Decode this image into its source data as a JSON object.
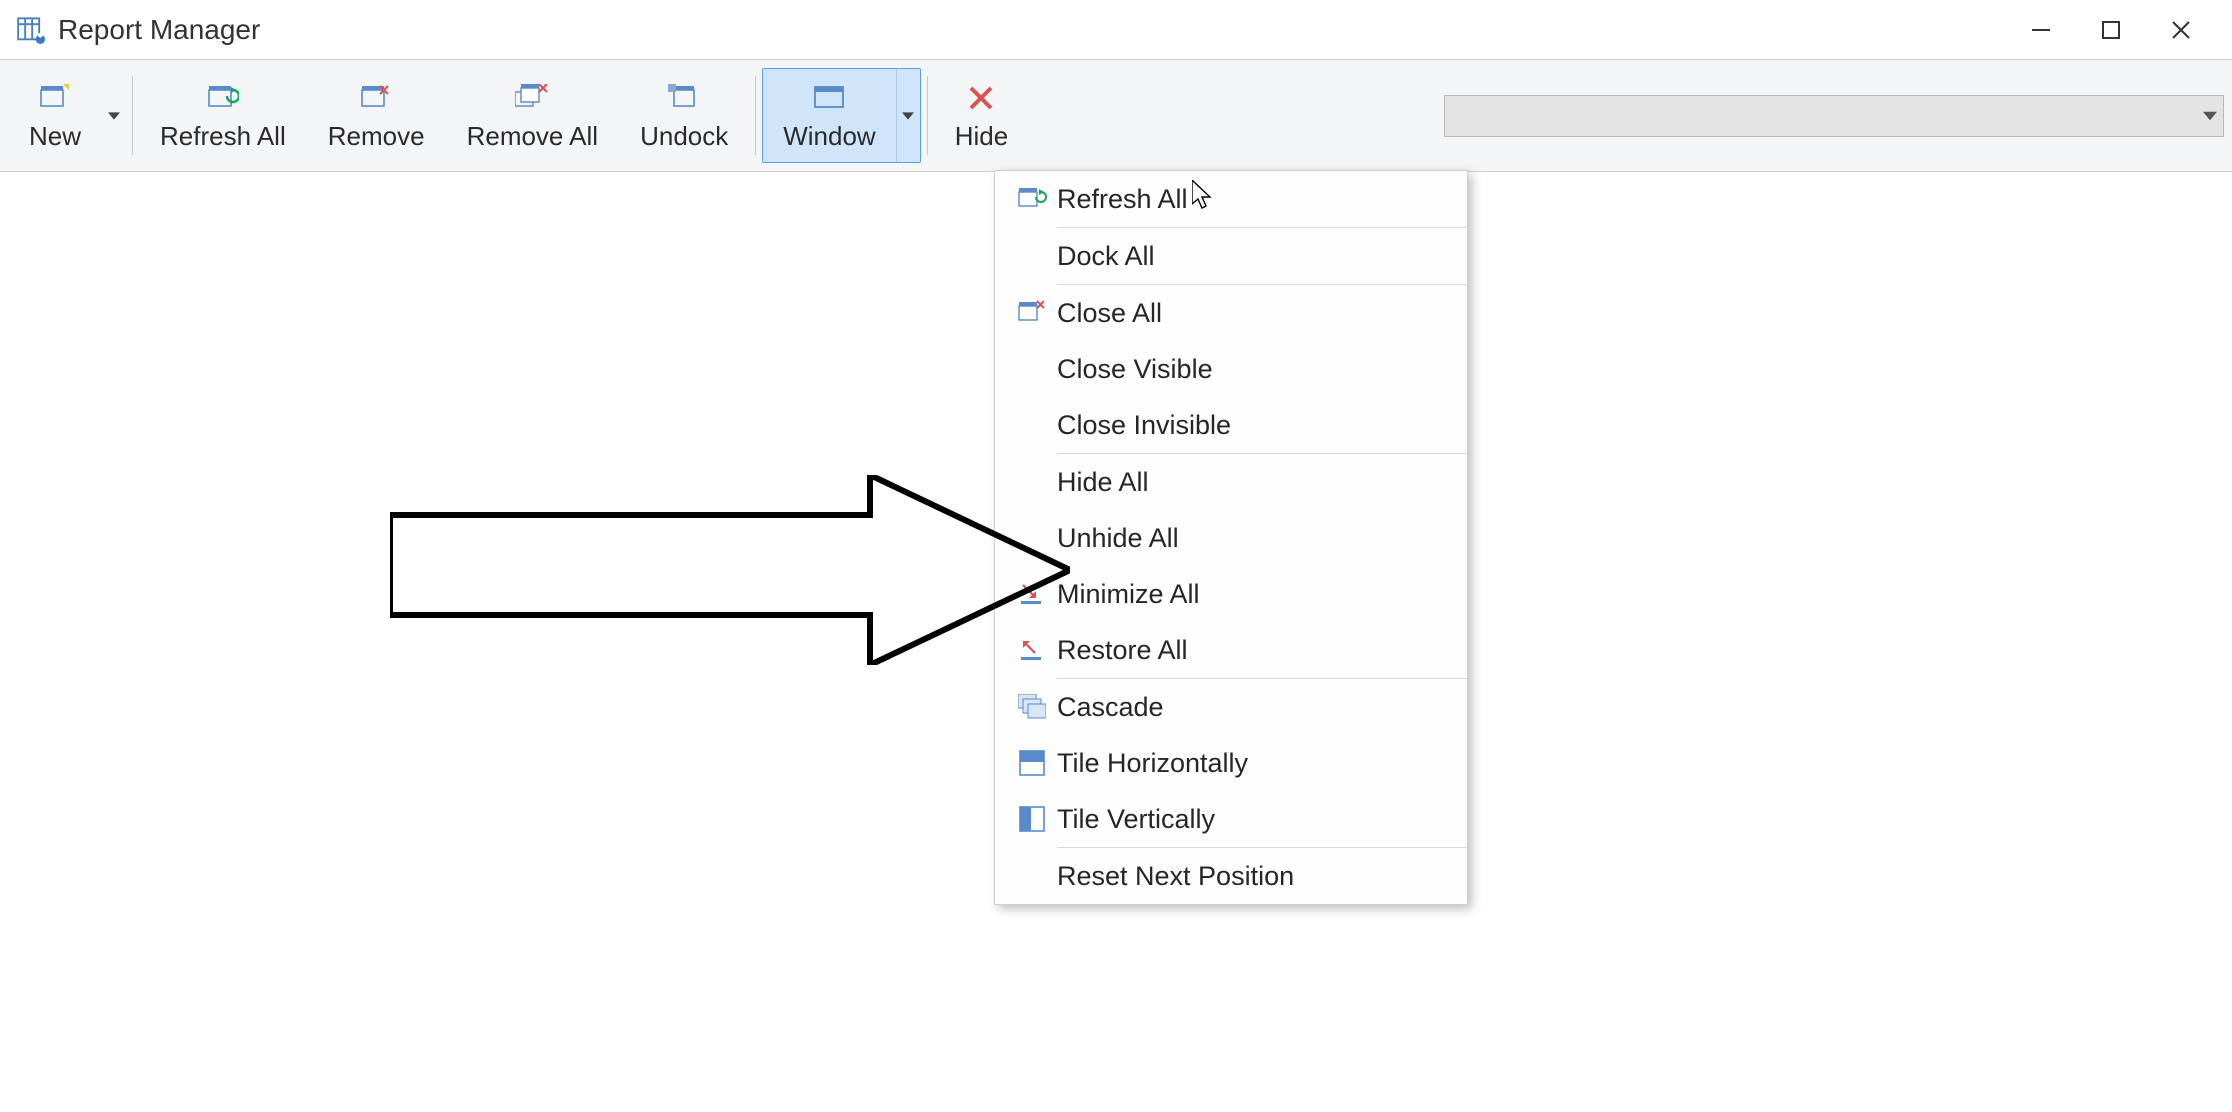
{
  "window": {
    "title": "Report Manager"
  },
  "toolbar": {
    "new": "New",
    "refreshAll": "Refresh All",
    "remove": "Remove",
    "removeAll": "Remove All",
    "undock": "Undock",
    "window": "Window",
    "hide": "Hide"
  },
  "menu": [
    {
      "icon": "refresh-all-icon",
      "label": "Refresh All",
      "sepAfter": true
    },
    {
      "icon": "",
      "label": "Dock All",
      "sepAfter": true
    },
    {
      "icon": "close-all-icon",
      "label": "Close All",
      "sepAfter": false
    },
    {
      "icon": "",
      "label": "Close Visible",
      "sepAfter": false
    },
    {
      "icon": "",
      "label": "Close Invisible",
      "sepAfter": true
    },
    {
      "icon": "",
      "label": "Hide All",
      "sepAfter": false
    },
    {
      "icon": "",
      "label": "Unhide All",
      "sepAfter": false
    },
    {
      "icon": "minimize-all-icon",
      "label": "Minimize All",
      "sepAfter": false
    },
    {
      "icon": "restore-all-icon",
      "label": "Restore All",
      "sepAfter": true
    },
    {
      "icon": "cascade-icon",
      "label": "Cascade",
      "sepAfter": false
    },
    {
      "icon": "tile-h-icon",
      "label": "Tile Horizontally",
      "sepAfter": false
    },
    {
      "icon": "tile-v-icon",
      "label": "Tile Vertically",
      "sepAfter": true
    },
    {
      "icon": "",
      "label": "Reset Next Position",
      "sepAfter": false
    }
  ]
}
